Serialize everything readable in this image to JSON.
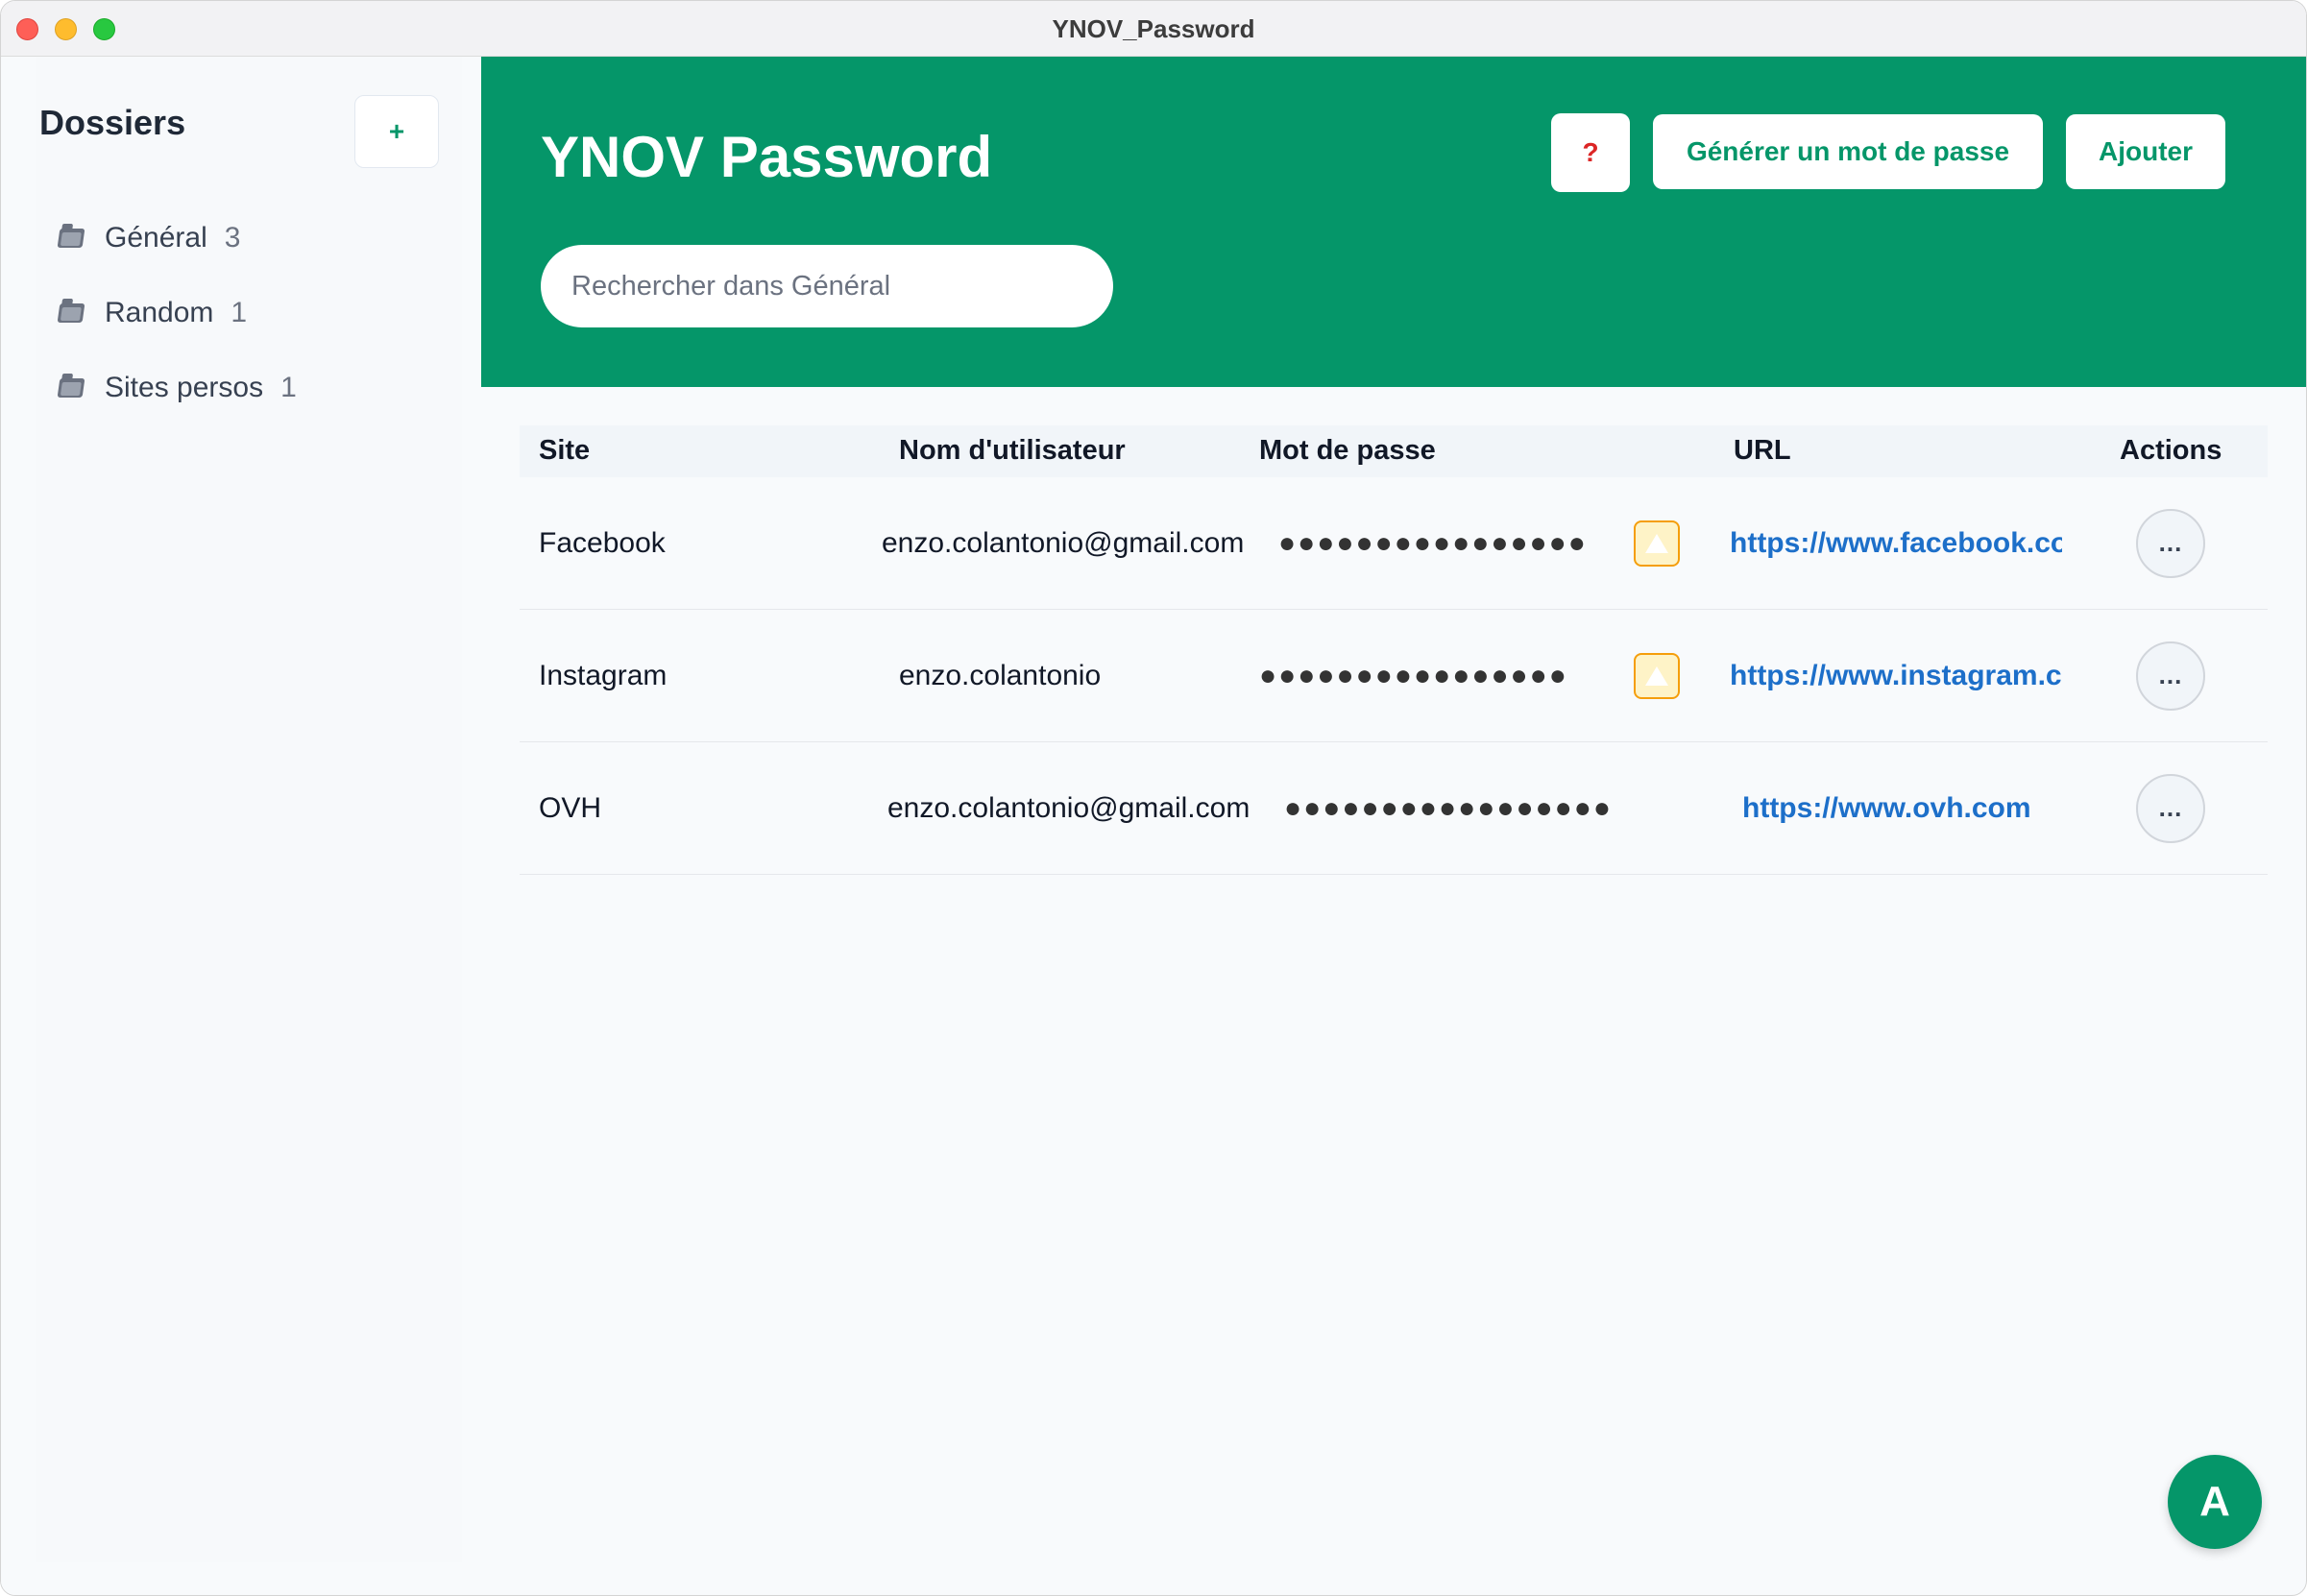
{
  "window": {
    "title": "YNOV_Password"
  },
  "sidebar": {
    "title": "Dossiers",
    "add_label": "+",
    "folders": [
      {
        "label": "Général",
        "count": "3"
      },
      {
        "label": "Random",
        "count": "1"
      },
      {
        "label": "Sites persos",
        "count": "1"
      }
    ]
  },
  "header": {
    "title": "YNOV Password",
    "help_label": "?",
    "generate_label": "Générer un mot de passe",
    "add_label": "Ajouter",
    "search_placeholder": "Rechercher dans Général"
  },
  "table": {
    "columns": {
      "site": "Site",
      "username": "Nom d'utilisateur",
      "password": "Mot de passe",
      "url": "URL",
      "actions": "Actions"
    },
    "rows": [
      {
        "site": "Facebook",
        "username": "enzo.colantonio@gmail.com",
        "password": "●●●●●●●●●●●●●●●●",
        "warning": true,
        "url": "https://www.facebook.com",
        "actions_label": "..."
      },
      {
        "site": "Instagram",
        "username": "enzo.colantonio",
        "password": "●●●●●●●●●●●●●●●●",
        "warning": true,
        "url": "https://www.instagram.com",
        "actions_label": "..."
      },
      {
        "site": "OVH",
        "username": "enzo.colantonio@gmail.com",
        "password": "●●●●●●●●●●●●●●●●●",
        "warning": false,
        "url": "https://www.ovh.com",
        "actions_label": "..."
      }
    ]
  },
  "user": {
    "avatar_initial": "A"
  },
  "colors": {
    "brand": "#059669",
    "link": "#1d6fc9",
    "warning": "#f59e0b"
  }
}
